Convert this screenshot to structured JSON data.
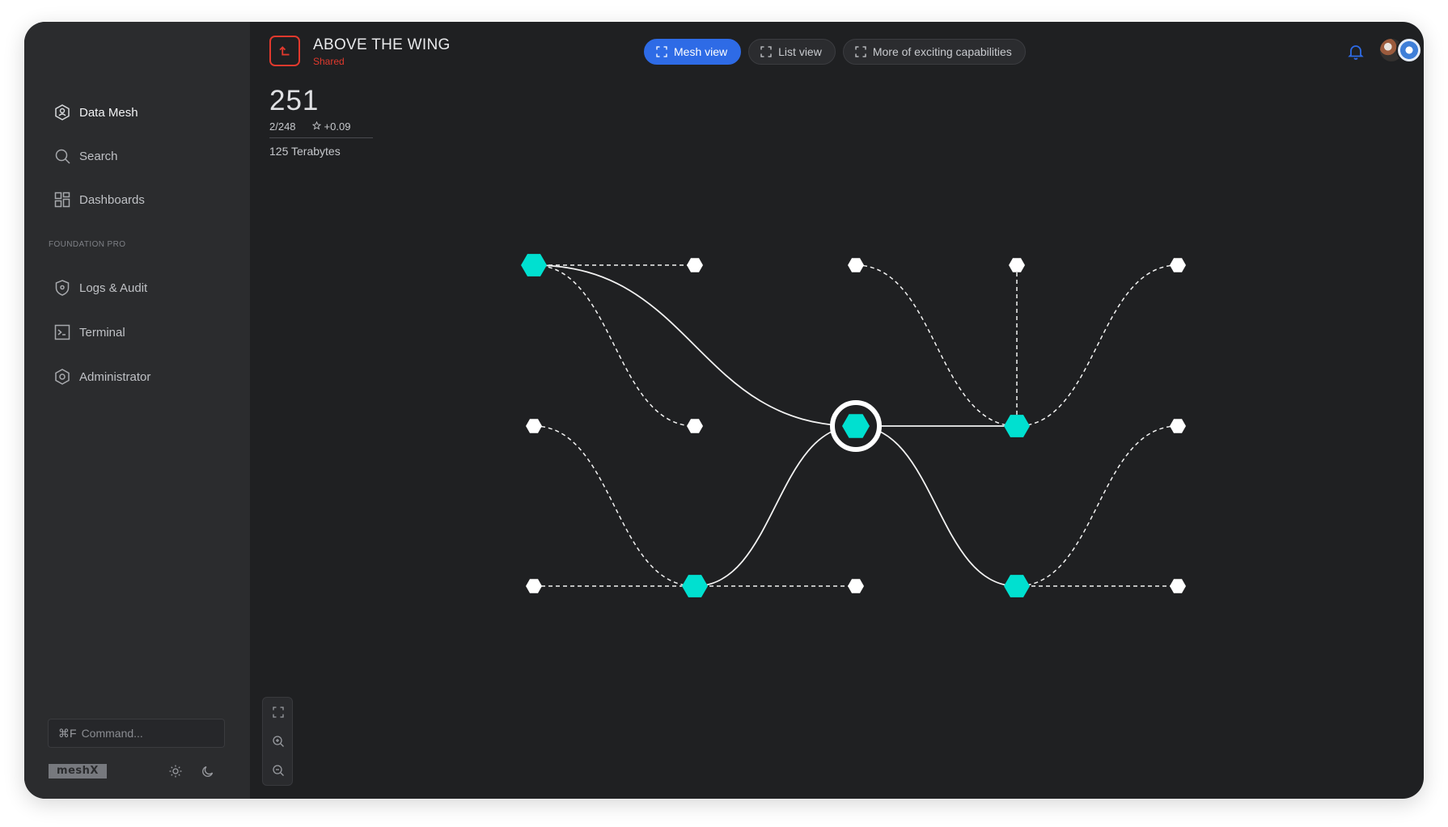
{
  "sidebar": {
    "items": [
      {
        "label": "Data Mesh",
        "icon": "data-mesh-icon",
        "active": true
      },
      {
        "label": "Search",
        "icon": "search-icon"
      },
      {
        "label": "Dashboards",
        "icon": "dashboards-icon"
      }
    ],
    "section_label": "FOUNDATION PRO",
    "section_items": [
      {
        "label": "Logs & Audit",
        "icon": "shield-icon"
      },
      {
        "label": "Terminal",
        "icon": "terminal-icon"
      },
      {
        "label": "Administrator",
        "icon": "admin-gear-icon"
      }
    ],
    "command": {
      "shortcut": "⌘F",
      "placeholder": "Command..."
    },
    "logo_text": "meshX"
  },
  "header": {
    "title": "ABOVE THE WING",
    "subtitle": "Shared",
    "tabs": [
      {
        "label": "Mesh view",
        "active": true
      },
      {
        "label": "List view",
        "active": false
      },
      {
        "label": "More of exciting capabilities",
        "active": false
      }
    ]
  },
  "stats": {
    "total": "251",
    "ratio": "2/248",
    "rating_delta": "+0.09",
    "capacity": "125 Terabytes"
  },
  "colors": {
    "accent_blue": "#2e6be6",
    "brand_red": "#e0392d",
    "node_cyan": "#00e0d0",
    "node_white": "#ffffff",
    "background": "#1f2022",
    "sidebar": "#2b2c2e"
  },
  "mesh": {
    "hub": "hub",
    "nodes": [
      {
        "id": "a",
        "type": "primary",
        "col": 0,
        "row": 0
      },
      {
        "id": "b",
        "type": "leaf",
        "col": 1,
        "row": 0
      },
      {
        "id": "c",
        "type": "leaf",
        "col": 2,
        "row": 0
      },
      {
        "id": "d",
        "type": "leaf",
        "col": 3,
        "row": 0
      },
      {
        "id": "e",
        "type": "leaf",
        "col": 4,
        "row": 0
      },
      {
        "id": "f",
        "type": "leaf",
        "col": 0,
        "row": 1
      },
      {
        "id": "g",
        "type": "leaf",
        "col": 1,
        "row": 1
      },
      {
        "id": "hub",
        "type": "hub",
        "col": 2,
        "row": 1
      },
      {
        "id": "h",
        "type": "primary",
        "col": 3,
        "row": 1
      },
      {
        "id": "i",
        "type": "leaf",
        "col": 4,
        "row": 1
      },
      {
        "id": "j",
        "type": "leaf",
        "col": 0,
        "row": 2
      },
      {
        "id": "k",
        "type": "primary",
        "col": 1,
        "row": 2
      },
      {
        "id": "l",
        "type": "leaf",
        "col": 2,
        "row": 2
      },
      {
        "id": "m",
        "type": "primary",
        "col": 3,
        "row": 2
      },
      {
        "id": "n",
        "type": "leaf",
        "col": 4,
        "row": 2
      }
    ],
    "edges": [
      {
        "from": "a",
        "to": "hub",
        "style": "solid"
      },
      {
        "from": "k",
        "to": "hub",
        "style": "solid"
      },
      {
        "from": "hub",
        "to": "h",
        "style": "solid"
      },
      {
        "from": "hub",
        "to": "m",
        "style": "solid"
      },
      {
        "from": "a",
        "to": "b",
        "style": "dashed"
      },
      {
        "from": "a",
        "to": "g",
        "style": "dashed"
      },
      {
        "from": "c",
        "to": "h",
        "style": "dashed"
      },
      {
        "from": "d",
        "to": "h",
        "style": "dashed"
      },
      {
        "from": "e",
        "to": "h",
        "style": "dashed"
      },
      {
        "from": "f",
        "to": "k",
        "style": "dashed"
      },
      {
        "from": "j",
        "to": "k",
        "style": "dashed"
      },
      {
        "from": "k",
        "to": "l",
        "style": "dashed"
      },
      {
        "from": "i",
        "to": "m",
        "style": "dashed"
      },
      {
        "from": "m",
        "to": "n",
        "style": "dashed"
      }
    ]
  },
  "zoom_controls": [
    {
      "icon": "fit-screen-icon"
    },
    {
      "icon": "zoom-in-icon"
    },
    {
      "icon": "zoom-out-icon"
    }
  ]
}
